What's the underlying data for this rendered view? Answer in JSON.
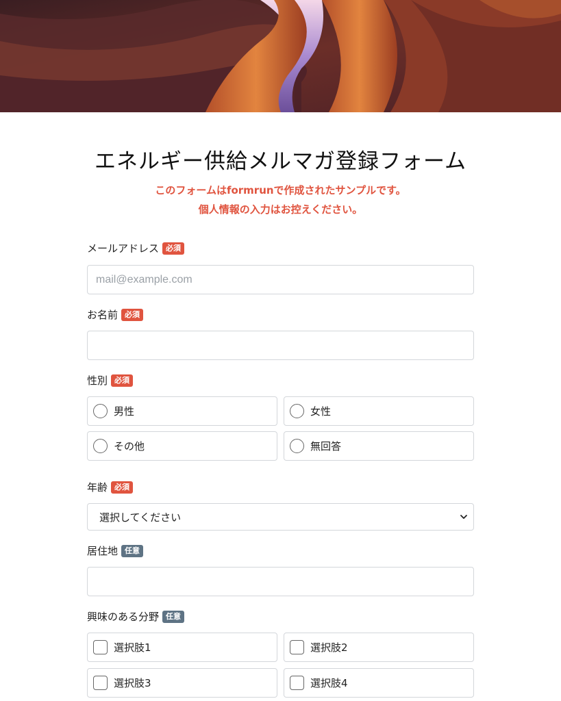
{
  "form": {
    "title": "エネルギー供給メルマガ登録フォーム",
    "notice_line1": "このフォームはformrunで作成されたサンプルです。",
    "notice_line2": "個人情報の入力はお控えください。"
  },
  "badges": {
    "required": "必須",
    "optional": "任意"
  },
  "email": {
    "label": "メールアドレス",
    "placeholder": "mail@example.com",
    "value": ""
  },
  "name": {
    "label": "お名前",
    "value": ""
  },
  "gender": {
    "label": "性別",
    "options": [
      "男性",
      "女性",
      "その他",
      "無回答"
    ]
  },
  "age": {
    "label": "年齢",
    "selected": "選択してください"
  },
  "residence": {
    "label": "居住地",
    "value": ""
  },
  "interests": {
    "label": "興味のある分野",
    "options": [
      "選択肢1",
      "選択肢2",
      "選択肢3",
      "選択肢4"
    ]
  },
  "icons": {
    "select_arrow": "chevron-down-icon",
    "radio": "radio-circle-icon",
    "checkbox": "checkbox-icon"
  },
  "colors": {
    "required_badge": "#e0543f",
    "optional_badge": "#5e7384",
    "notice_text": "#e0543f"
  }
}
